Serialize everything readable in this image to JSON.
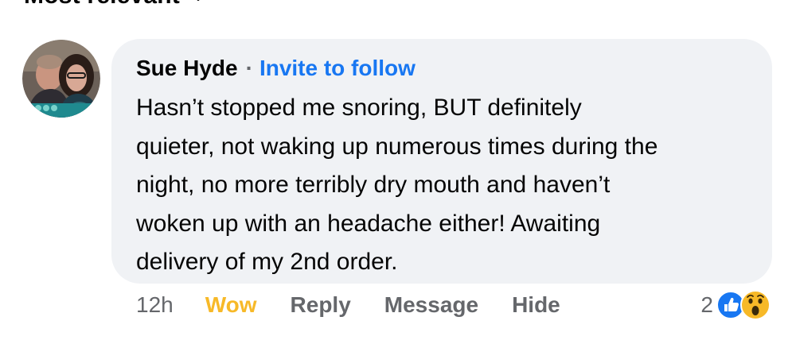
{
  "sort": {
    "label": "Most relevant",
    "icon": "chevron-down-icon"
  },
  "comment": {
    "avatar_icon": "user-avatar",
    "author": "Sue Hyde",
    "separator": "·",
    "invite_label": "Invite to follow",
    "text": "Hasn’t stopped me snoring, BUT definitely\nquieter, not waking up numerous times during the\nnight, no more terribly dry mouth and haven’t\nwoken up with an headache either!  Awaiting\ndelivery of my 2nd order.",
    "timestamp": "12h",
    "actions": {
      "wow_label": "Wow",
      "reply_label": "Reply",
      "message_label": "Message",
      "hide_label": "Hide"
    },
    "reactions": {
      "count": "2",
      "types": [
        "like-icon",
        "wow-emoji-icon"
      ]
    }
  },
  "colors": {
    "bubble_bg": "#f0f2f5",
    "link_blue": "#1877f2",
    "wow_yellow": "#f7b928",
    "secondary_text": "#65676b",
    "primary_text": "#050505"
  }
}
